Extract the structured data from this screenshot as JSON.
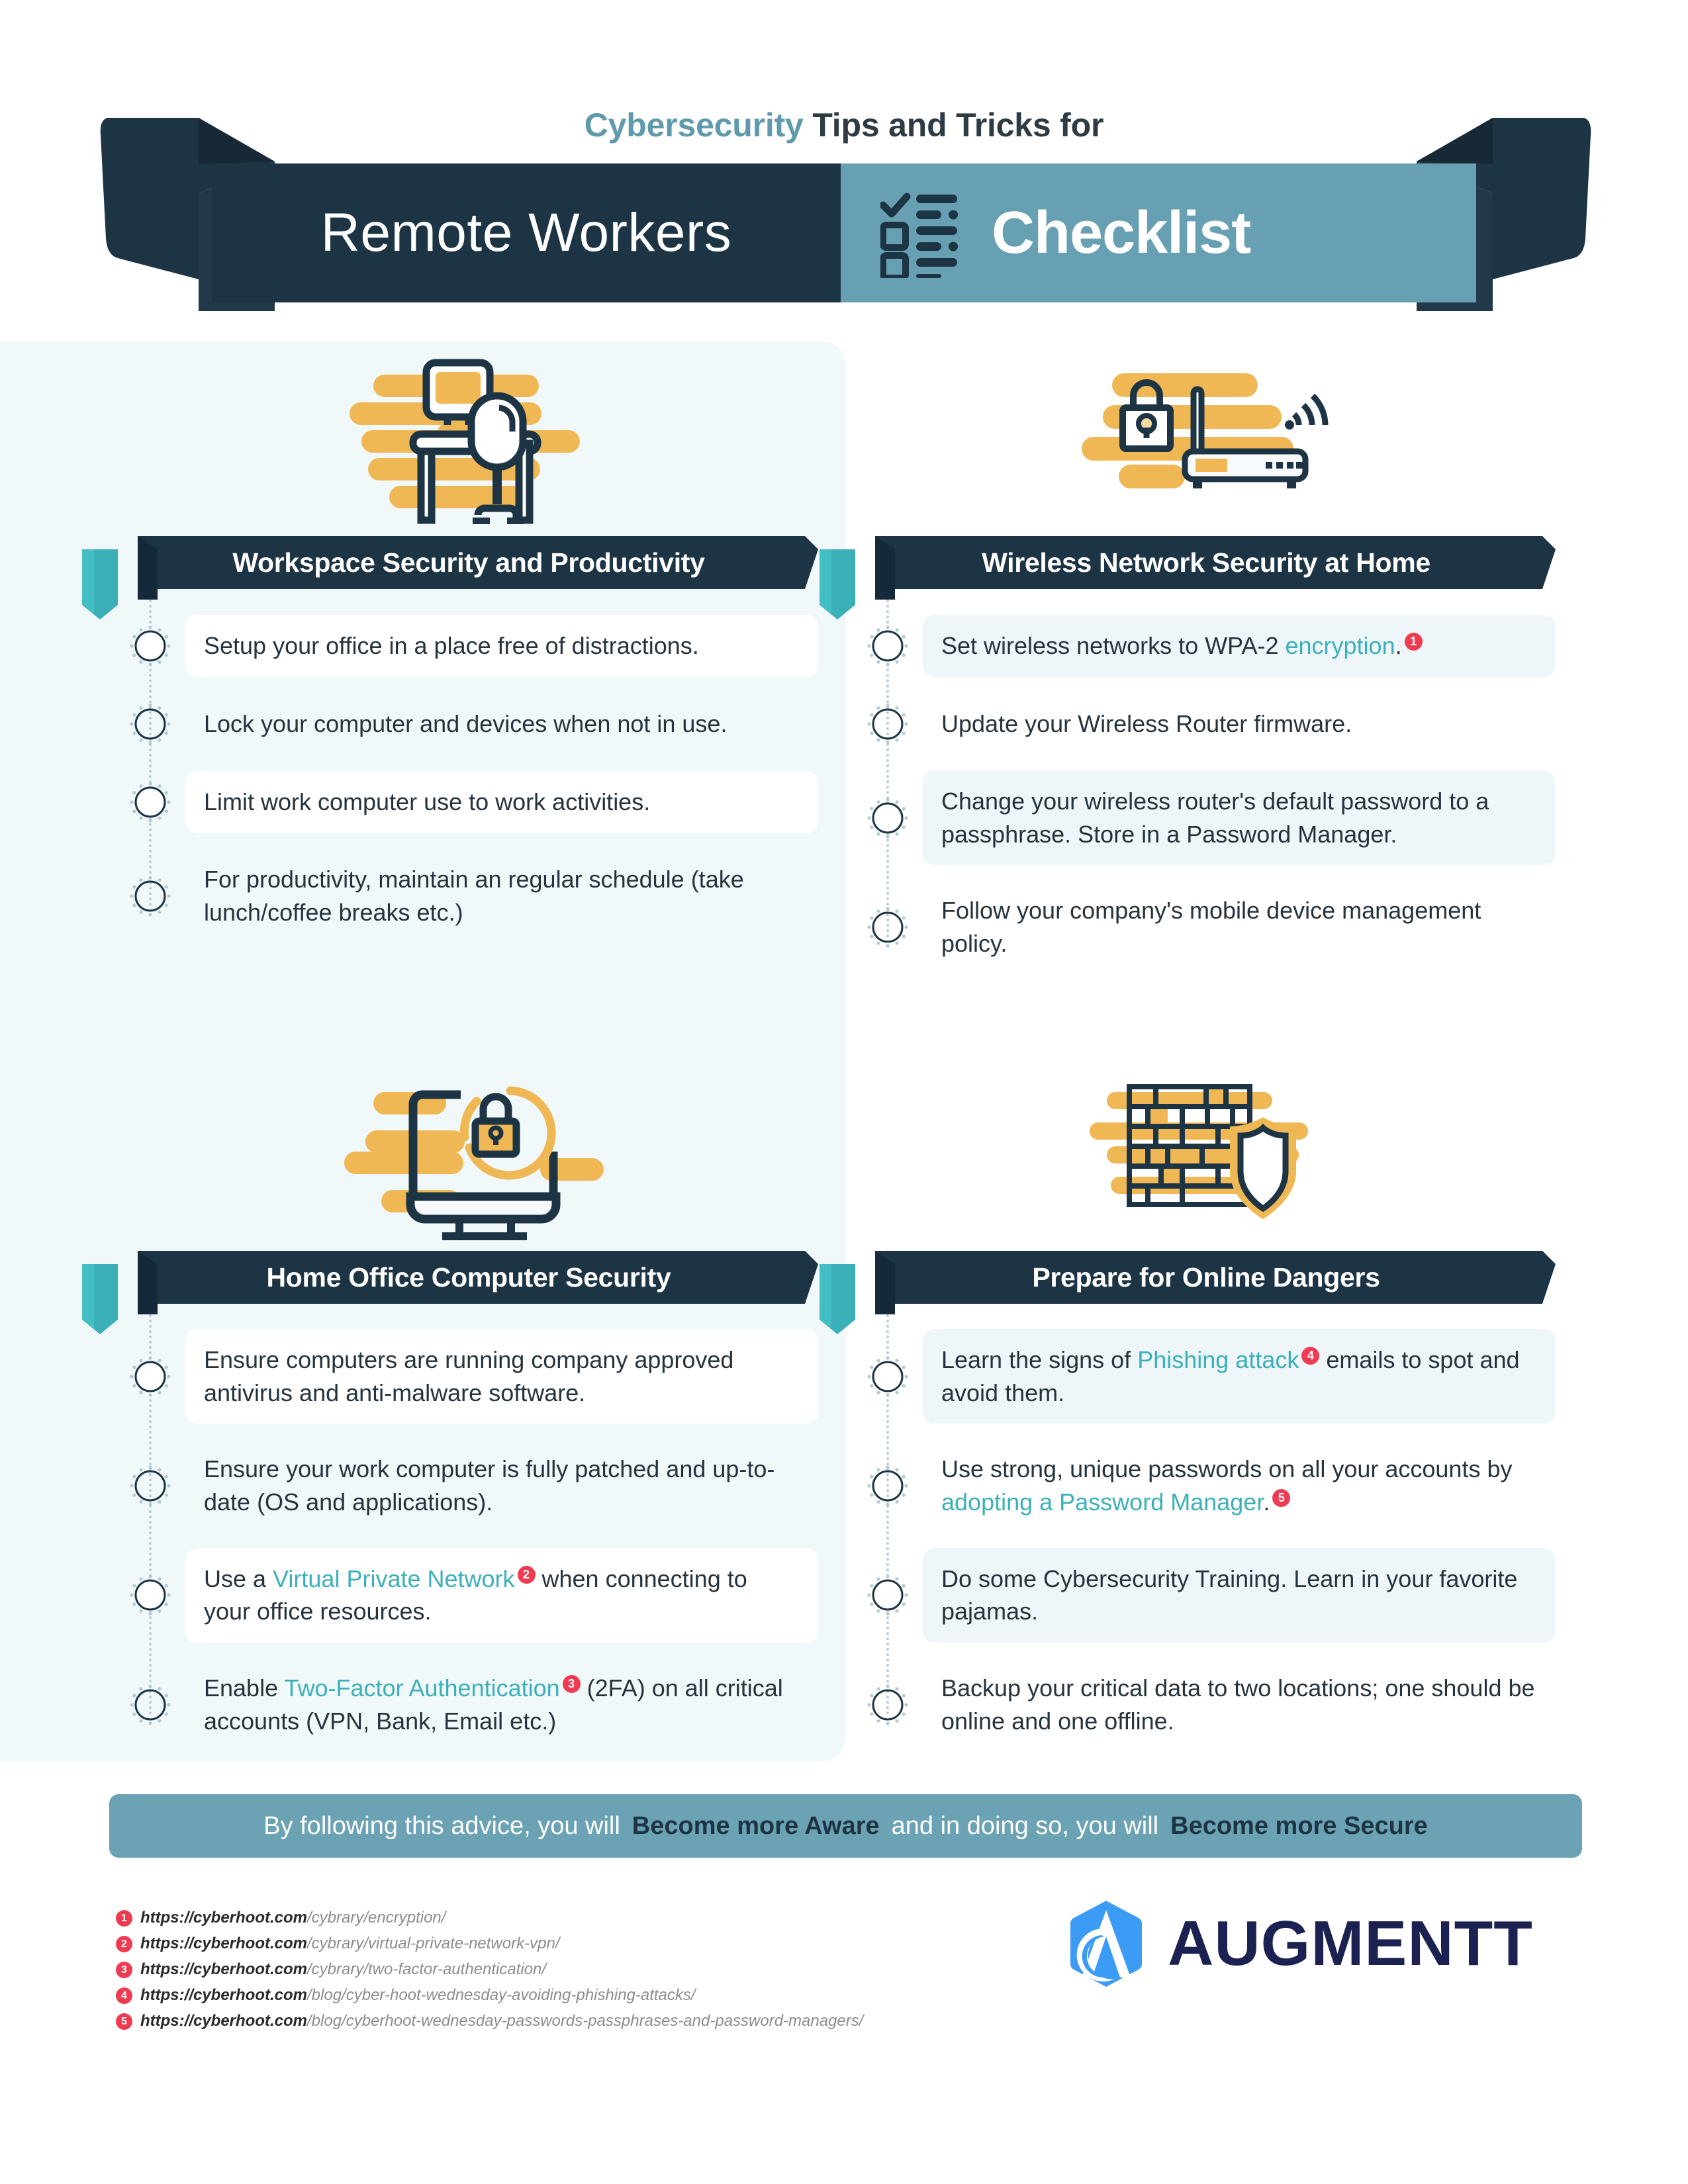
{
  "header": {
    "sub_accent": "Cybersecurity",
    "sub_rest": " Tips and Tricks for",
    "banner_left": "Remote Workers",
    "banner_right": "Checklist",
    "checklist_icon": "checklist-icon"
  },
  "sections": [
    {
      "icon": "desk-chair-monitor-icon",
      "title": "Workspace Security and Productivity",
      "items": [
        {
          "style": "white",
          "text": "Setup your office in a place free of distractions."
        },
        {
          "style": "none",
          "text": "Lock your computer and devices when not in use."
        },
        {
          "style": "white",
          "text": "Limit work computer use to work activities."
        },
        {
          "style": "none",
          "text": "For productivity, maintain an regular schedule (take lunch/coffee breaks etc.)"
        }
      ]
    },
    {
      "icon": "wireless-router-lock-icon",
      "title": "Wireless Network Security at Home",
      "items": [
        {
          "style": "tinted",
          "text": "Set wireless networks to WPA-2 ",
          "highlight": "encryption",
          "after": ".",
          "ref": "1"
        },
        {
          "style": "none",
          "text": "Update your Wireless Router firmware."
        },
        {
          "style": "tinted",
          "text": "Change your wireless router's default password to a passphrase. Store in a Password Manager."
        },
        {
          "style": "none",
          "text": "Follow your company's mobile device management policy."
        }
      ]
    },
    {
      "icon": "monitor-padlock-icon",
      "title": "Home Office Computer Security",
      "items": [
        {
          "style": "white",
          "text": "Ensure computers are running company approved antivirus and anti-malware software."
        },
        {
          "style": "none",
          "text": "Ensure your work computer is fully patched and up-to-date (OS and applications)."
        },
        {
          "style": "white",
          "text": "Use a ",
          "highlight": "Virtual Private Network",
          "ref": "2",
          "after": " when connecting to your office resources."
        },
        {
          "style": "none",
          "text": "Enable ",
          "highlight": "Two-Factor Authentication",
          "ref": "3",
          "after": " (2FA) on all critical accounts (VPN, Bank, Email etc.)"
        }
      ]
    },
    {
      "icon": "firewall-shield-icon",
      "title": "Prepare for Online Dangers",
      "items": [
        {
          "style": "tinted",
          "text": "Learn the signs of ",
          "highlight": "Phishing attack",
          "ref": "4",
          "after": " emails to spot and avoid them."
        },
        {
          "style": "none",
          "text": "Use strong, unique passwords on all your accounts by ",
          "highlight": "adopting a Password Manager",
          "after": ".",
          "ref": "5"
        },
        {
          "style": "tinted",
          "text": "Do some Cybersecurity Training. Learn in your favorite pajamas."
        },
        {
          "style": "none",
          "text": "Backup your critical data to two locations; one should be online and one offline."
        }
      ]
    }
  ],
  "footer": {
    "part1": "By following this advice, you will",
    "part2": "Become more Aware",
    "part3": "and in doing so, you will",
    "part4": "Become more Secure"
  },
  "references": [
    {
      "num": "1",
      "domain": "https://cyberhoot.com",
      "path": "/cybrary/encryption/"
    },
    {
      "num": "2",
      "domain": "https://cyberhoot.com",
      "path": "/cybrary/virtual-private-network-vpn/"
    },
    {
      "num": "3",
      "domain": "https://cyberhoot.com",
      "path": "/cybrary/two-factor-authentication/"
    },
    {
      "num": "4",
      "domain": "https://cyberhoot.com",
      "path": "/blog/cyber-hoot-wednesday-avoiding-phishing-attacks/"
    },
    {
      "num": "5",
      "domain": "https://cyberhoot.com",
      "path": "/blog/cyberhoot-wednesday-passwords-passphrases-and-password-managers/"
    }
  ],
  "logo": {
    "name": "AUGMENTT",
    "mark": "augmentt-logo-mark"
  },
  "colors": {
    "navy": "#1d3444",
    "steel_blue": "#68a0b3",
    "teal": "#3bb0b8",
    "yellow": "#f0b855",
    "red": "#ef3b52",
    "panel_tint": "#f1f8fa",
    "card_tinted": "#eef6f9"
  }
}
